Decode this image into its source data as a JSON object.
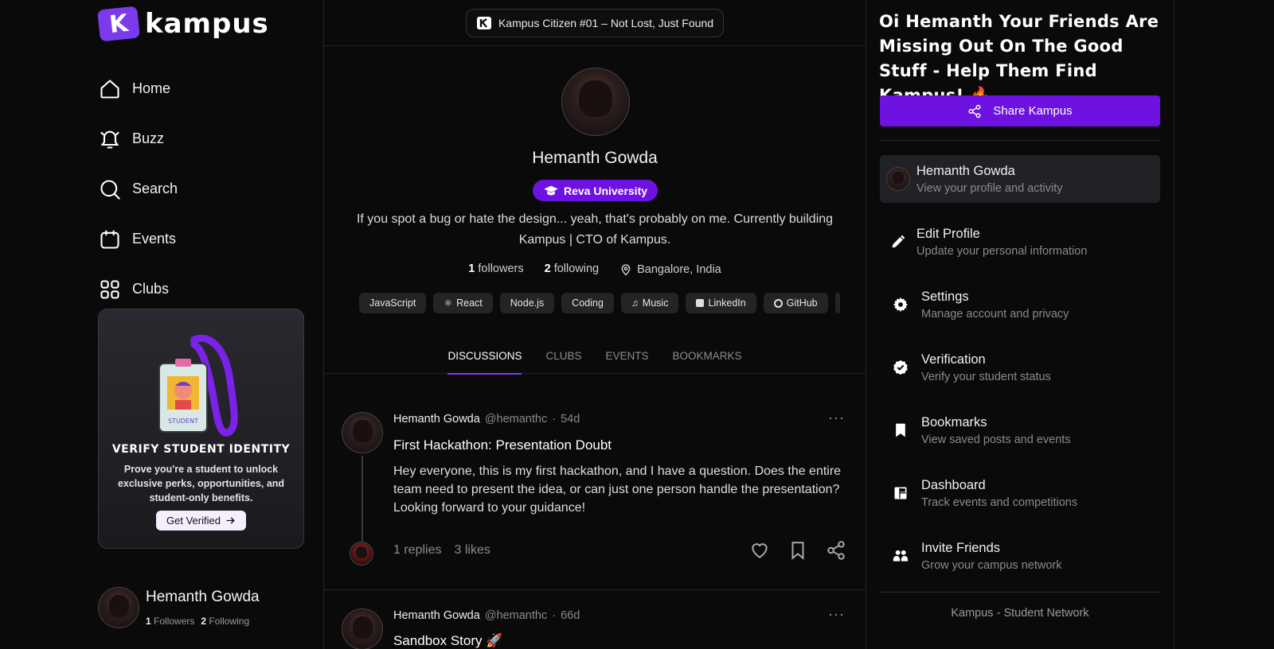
{
  "brand": {
    "name": "kampus",
    "mark": "K",
    "accent": "#6d12e0"
  },
  "nav": [
    {
      "label": "Home",
      "icon": "home-icon"
    },
    {
      "label": "Buzz",
      "icon": "bell-icon"
    },
    {
      "label": "Search",
      "icon": "search-icon"
    },
    {
      "label": "Events",
      "icon": "calendar-icon"
    },
    {
      "label": "Clubs",
      "icon": "grid-icon"
    }
  ],
  "verify_card": {
    "badge_text": "STUDENT",
    "title": "VERIFY STUDENT IDENTITY",
    "description": "Prove you're a student to unlock exclusive perks, opportunities, and student-only benefits.",
    "button": "Get Verified"
  },
  "sidebar_user": {
    "name": "Hemanth Gowda",
    "followers": "1",
    "followers_label": "Followers",
    "following": "2",
    "following_label": "Following"
  },
  "top_banner": "Kampus Citizen #01 – Not Lost, Just Found",
  "profile": {
    "name": "Hemanth Gowda",
    "university": "Reva University",
    "bio": "If you spot a bug or hate the design... yeah, that's probably on me. Currently building Kampus | CTO of Kampus.",
    "followers": "1",
    "followers_label": "followers",
    "following": "2",
    "following_label": "following",
    "location": "Bangalore, India",
    "tags": [
      "JavaScript",
      "React",
      "Node.js",
      "Coding",
      "Music",
      "LinkedIn",
      "GitHub"
    ]
  },
  "tabs": [
    "DISCUSSIONS",
    "CLUBS",
    "EVENTS",
    "BOOKMARKS"
  ],
  "posts": [
    {
      "author": "Hemanth Gowda",
      "handle": "@hemanthc",
      "age": "54d",
      "title": "First Hackathon: Presentation Doubt",
      "body": "Hey everyone, this is my first hackathon, and I have a question. Does the entire team need to present the idea, or can just one person handle the presentation? Looking forward to your guidance!",
      "replies": "1 replies",
      "likes": "3 likes"
    },
    {
      "author": "Hemanth Gowda",
      "handle": "@hemanthc",
      "age": "66d",
      "title": "Sandbox Story 🚀"
    }
  ],
  "promo": {
    "text": "Oi Hemanth Your Friends Are Missing Out On The Good Stuff - Help Them Find Kampus! 🔥",
    "button": "Share Kampus"
  },
  "menu": [
    {
      "title": "Hemanth Gowda",
      "subtitle": "View your profile and activity",
      "icon": "avatar"
    },
    {
      "title": "Edit Profile",
      "subtitle": "Update your personal information",
      "icon": "pencil-icon"
    },
    {
      "title": "Settings",
      "subtitle": "Manage account and privacy",
      "icon": "gear-icon"
    },
    {
      "title": "Verification",
      "subtitle": "Verify your student status",
      "icon": "verified-badge-icon"
    },
    {
      "title": "Bookmarks",
      "subtitle": "View saved posts and events",
      "icon": "bookmark-icon"
    },
    {
      "title": "Dashboard",
      "subtitle": "Track events and competitions",
      "icon": "dashboard-icon"
    },
    {
      "title": "Invite Friends",
      "subtitle": "Grow your campus network",
      "icon": "people-icon"
    }
  ],
  "footer": "Kampus - Student Network"
}
